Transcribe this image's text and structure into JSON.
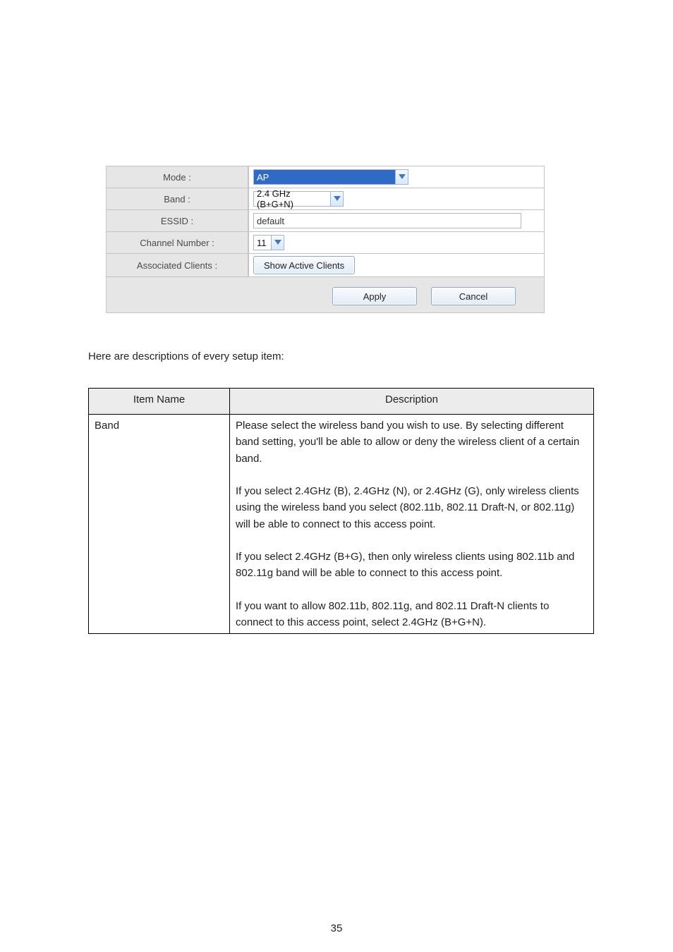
{
  "config": {
    "mode_label": "Mode :",
    "mode_value": "AP",
    "band_label": "Band :",
    "band_value": "2.4 GHz (B+G+N)",
    "essid_label": "ESSID :",
    "essid_value": "default",
    "channel_label": "Channel Number :",
    "channel_value": "11",
    "assoc_label": "Associated Clients :",
    "assoc_button": "Show Active Clients",
    "apply_label": "Apply",
    "cancel_label": "Cancel"
  },
  "interim_text": "Here are descriptions of every setup item:",
  "table": {
    "header_param": "Item Name",
    "header_desc": "Description",
    "rows": [
      {
        "param": "Band",
        "desc_parts": [
          "Please select the wireless band you wish to use. By selecting different band setting, you'll be able to allow or deny the wireless client of a certain band.",
          "",
          "If you select 2.4GHz (B), 2.4GHz (N), or 2.4GHz (G), only wireless clients using the wireless band you select (802.11b, 802.11 Draft-N, or 802.11g) will be able to connect to this access point.",
          "",
          "If you select 2.4GHz (B+G), then only wireless clients using 802.11b and 802.11g band will be able to connect to this access point.",
          "",
          "If you want to allow 802.11b, 802.11g, and 802.11 Draft-N clients to connect to this access point, select 2.4GHz (B+G+N)."
        ]
      }
    ]
  },
  "footer": {
    "page_number": "35"
  }
}
